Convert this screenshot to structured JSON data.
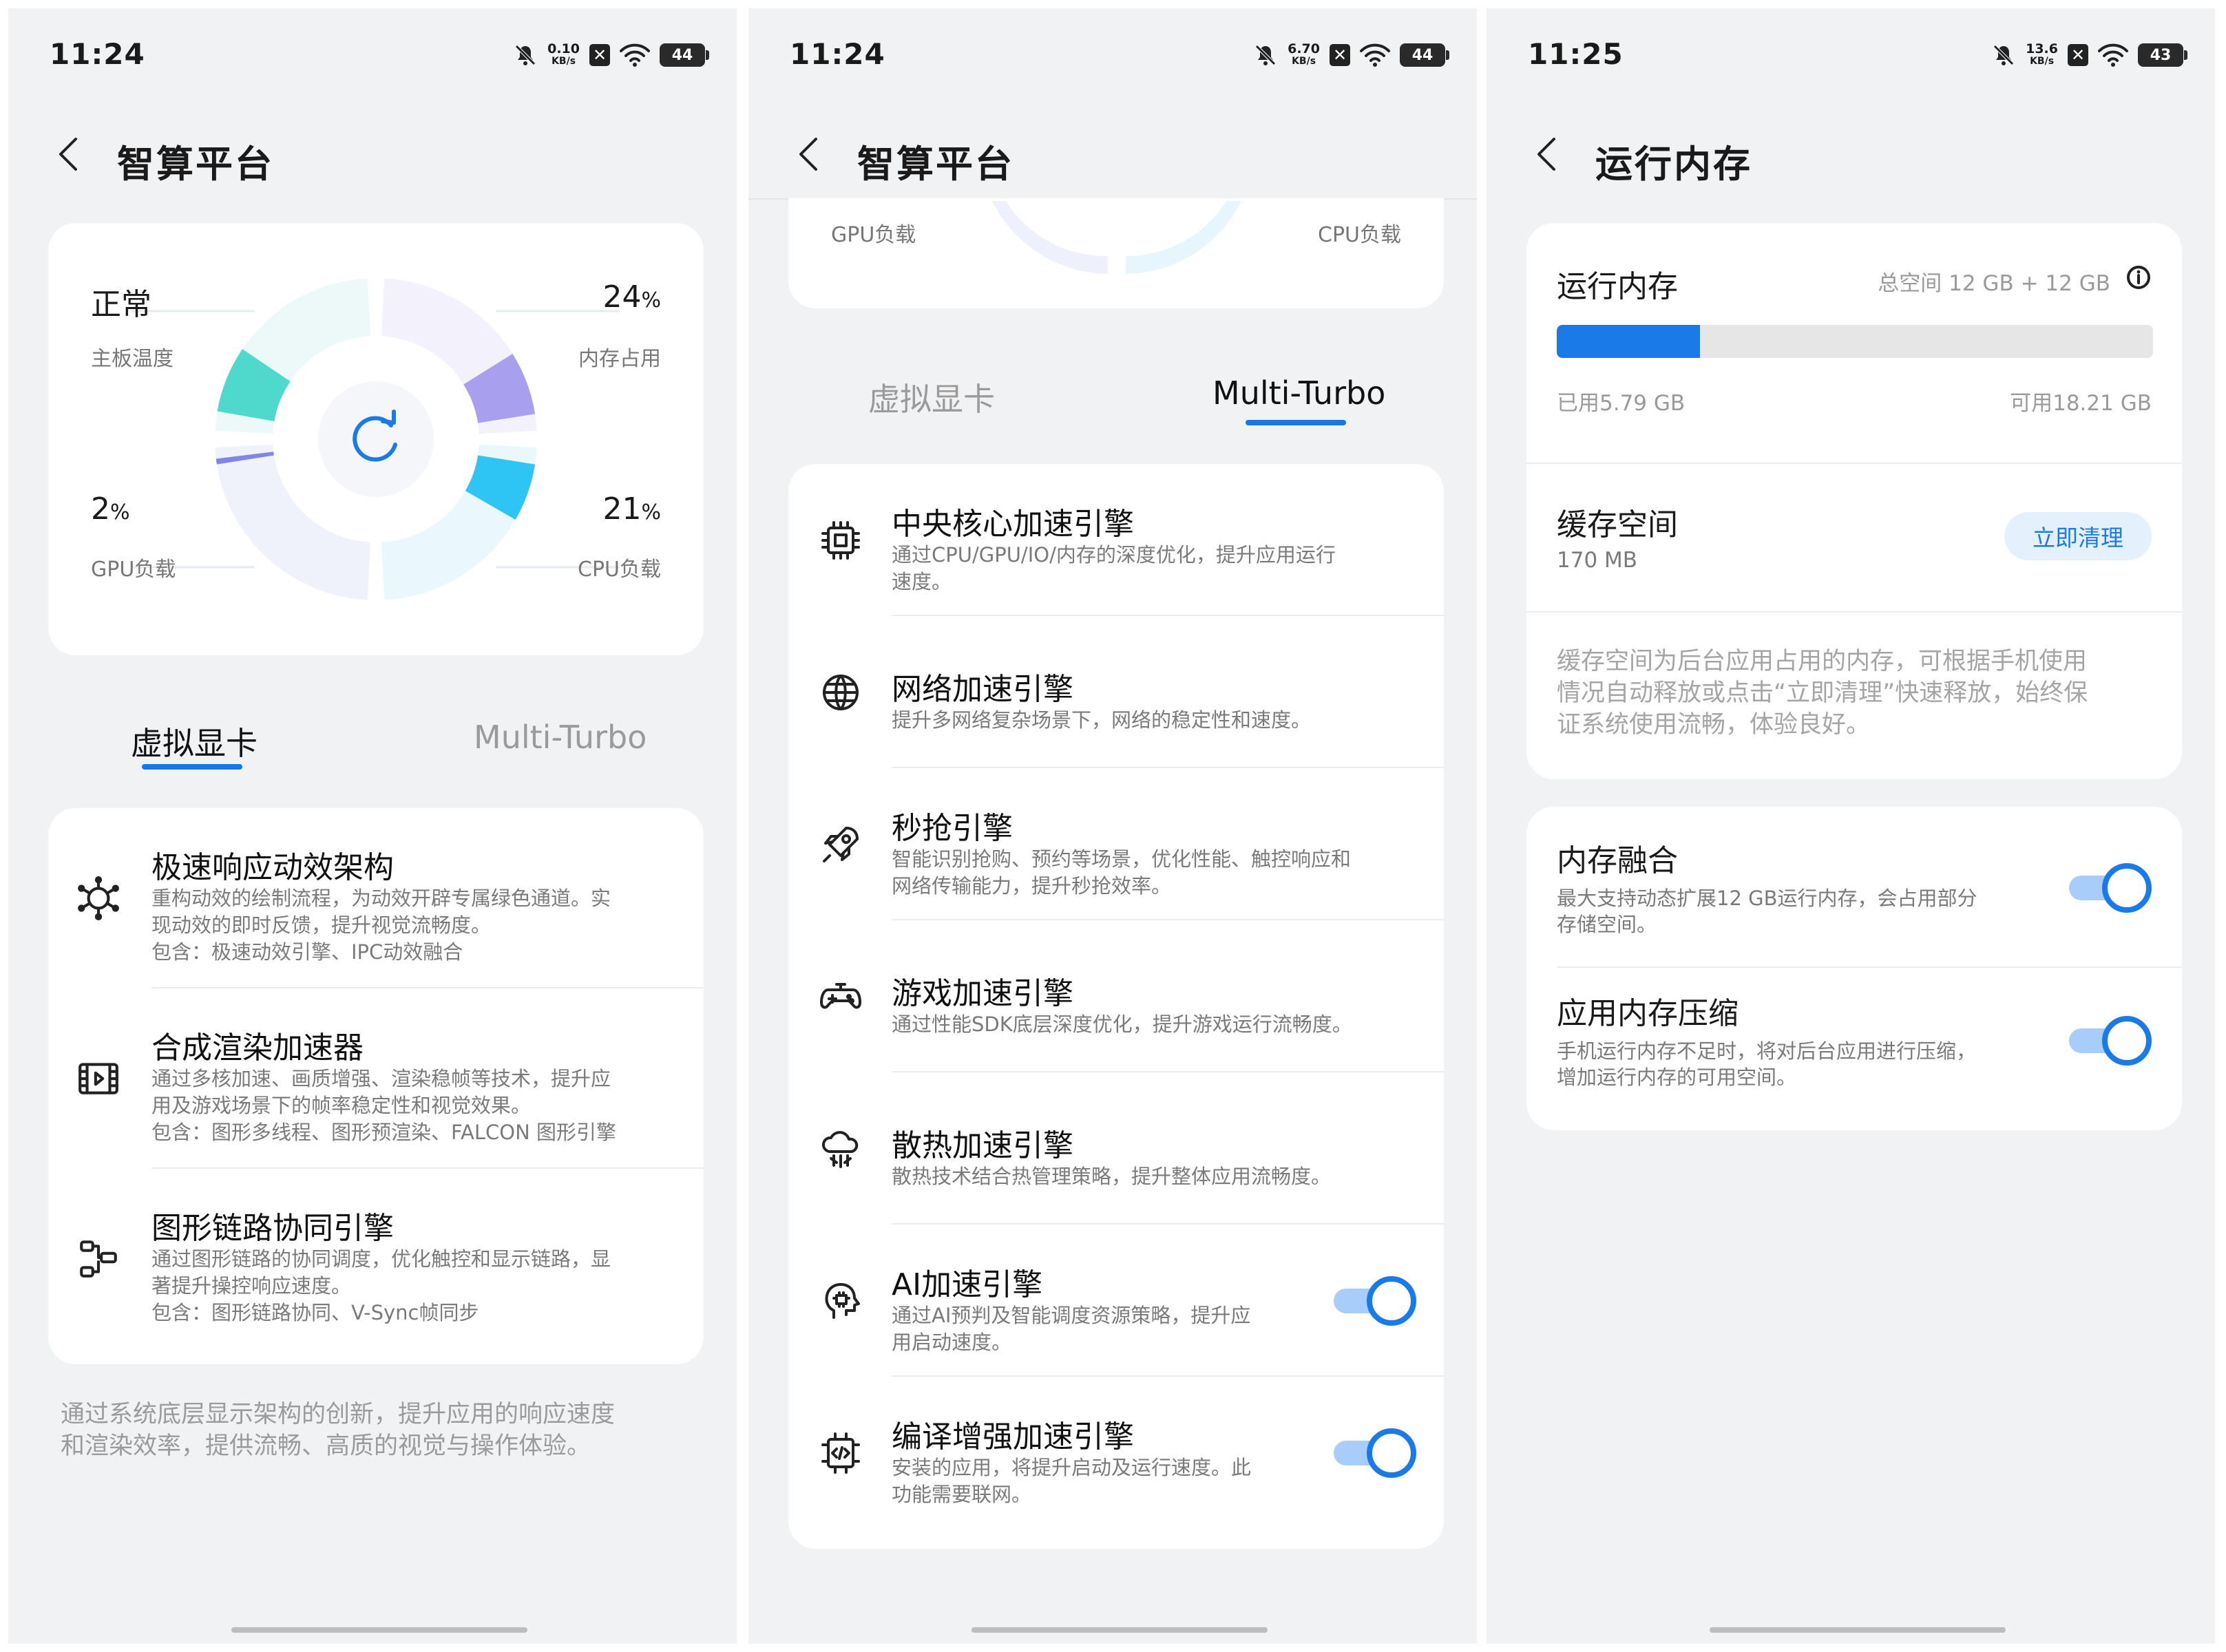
{
  "screen1": {
    "status": {
      "time": "11:24",
      "net_value": "0.10",
      "net_unit": "KB/s",
      "x_icon": "✕",
      "battery": "44"
    },
    "title": "智算平台",
    "dial": {
      "tl_value": "正常",
      "tl_label": "主板温度",
      "tr_value": "24",
      "tr_label": "内存占用",
      "bl_value": "2",
      "bl_label": "GPU负载",
      "br_value": "21",
      "br_label": "CPU负载",
      "pct": "%"
    },
    "tabs": [
      "虚拟显卡",
      "Multi-Turbo"
    ],
    "items": [
      {
        "title": "极速响应动效架构",
        "desc": [
          "重构动效的绘制流程，为动效开辟专属绿色通道。实",
          "现动效的即时反馈，提升视觉流畅度。",
          "包含：极速动效引擎、IPC动效融合"
        ],
        "icon": "cube-network-icon"
      },
      {
        "title": "合成渲染加速器",
        "desc": [
          "通过多核加速、画质增强、渲染稳帧等技术，提升应",
          "用及游戏场景下的帧率稳定性和视觉效果。",
          "包含：图形多线程、图形预渲染、FALCON 图形引擎"
        ],
        "icon": "film-icon"
      },
      {
        "title": "图形链路协同引擎",
        "desc": [
          "通过图形链路的协同调度，优化触控和显示链路，显",
          "著提升操控响应速度。",
          "包含：图形链路协同、V-Sync帧同步"
        ],
        "icon": "link-route-icon"
      }
    ],
    "footnote": [
      "通过系统底层显示架构的创新，提升应用的响应速度",
      "和渲染效率，提供流畅、高质的视觉与操作体验。"
    ]
  },
  "screen2": {
    "status": {
      "time": "11:24",
      "net_value": "6.70",
      "net_unit": "KB/s",
      "x_icon": "✕",
      "battery": "44"
    },
    "title": "智算平台",
    "dial_labels": {
      "left": "GPU负载",
      "right": "CPU负载"
    },
    "tabs": [
      "虚拟显卡",
      "Multi-Turbo"
    ],
    "items": [
      {
        "title": "中央核心加速引擎",
        "desc": [
          "通过CPU/GPU/IO/内存的深度优化，提升应用运行",
          "速度。"
        ],
        "icon": "chip-icon",
        "toggle": false
      },
      {
        "title": "网络加速引擎",
        "desc": [
          "提升多网络复杂场景下，网络的稳定性和速度。"
        ],
        "icon": "globe-icon",
        "toggle": false
      },
      {
        "title": "秒抢引擎",
        "desc": [
          "智能识别抢购、预约等场景，优化性能、触控响应和",
          "网络传输能力，提升秒抢效率。"
        ],
        "icon": "rocket-icon",
        "toggle": false
      },
      {
        "title": "游戏加速引擎",
        "desc": [
          "通过性能SDK底层深度优化，提升游戏运行流畅度。"
        ],
        "icon": "gamepad-icon",
        "toggle": false
      },
      {
        "title": "散热加速引擎",
        "desc": [
          "散热技术结合热管理策略，提升整体应用流畅度。"
        ],
        "icon": "cloud-cooling-icon",
        "toggle": false
      },
      {
        "title": "AI加速引擎",
        "desc": [
          "通过AI预判及智能调度资源策略，提升应",
          "用启动速度。"
        ],
        "icon": "ai-head-icon",
        "toggle": true
      },
      {
        "title": "编译增强加速引擎",
        "desc": [
          "安装的应用，将提升启动及运行速度。此",
          "功能需要联网。"
        ],
        "icon": "compile-chip-icon",
        "toggle": true
      }
    ]
  },
  "screen3": {
    "status": {
      "time": "11:25",
      "net_value": "13.6",
      "net_unit": "KB/s",
      "x_icon": "✕",
      "battery": "43"
    },
    "title": "运行内存",
    "memory": {
      "title": "运行内存",
      "total": "总空间 12 GB + 12 GB",
      "used": "已用5.79 GB",
      "available": "可用18.21 GB",
      "used_fraction": 0.24
    },
    "cache": {
      "title": "缓存空间",
      "size": "170 MB",
      "button": "立即清理",
      "note": [
        "缓存空间为后台应用占用的内存，可根据手机使用",
        "情况自动释放或点击“立即清理”快速释放，始终保",
        "证系统使用流畅，体验良好。"
      ]
    },
    "fusion": {
      "title": "内存融合",
      "desc": [
        "最大支持动态扩展12 GB运行内存，会占用部分",
        "存储空间。"
      ],
      "toggle": true
    },
    "compress": {
      "title": "应用内存压缩",
      "desc": [
        "手机运行内存不足时，将对后台应用进行压缩，",
        "增加运行内存的可用空间。"
      ],
      "toggle": true
    }
  },
  "colors": {
    "accent": "#1a7be8",
    "teal": "#4fd8cc",
    "purple": "#a8a0ee",
    "cyan": "#2ec5f5"
  }
}
